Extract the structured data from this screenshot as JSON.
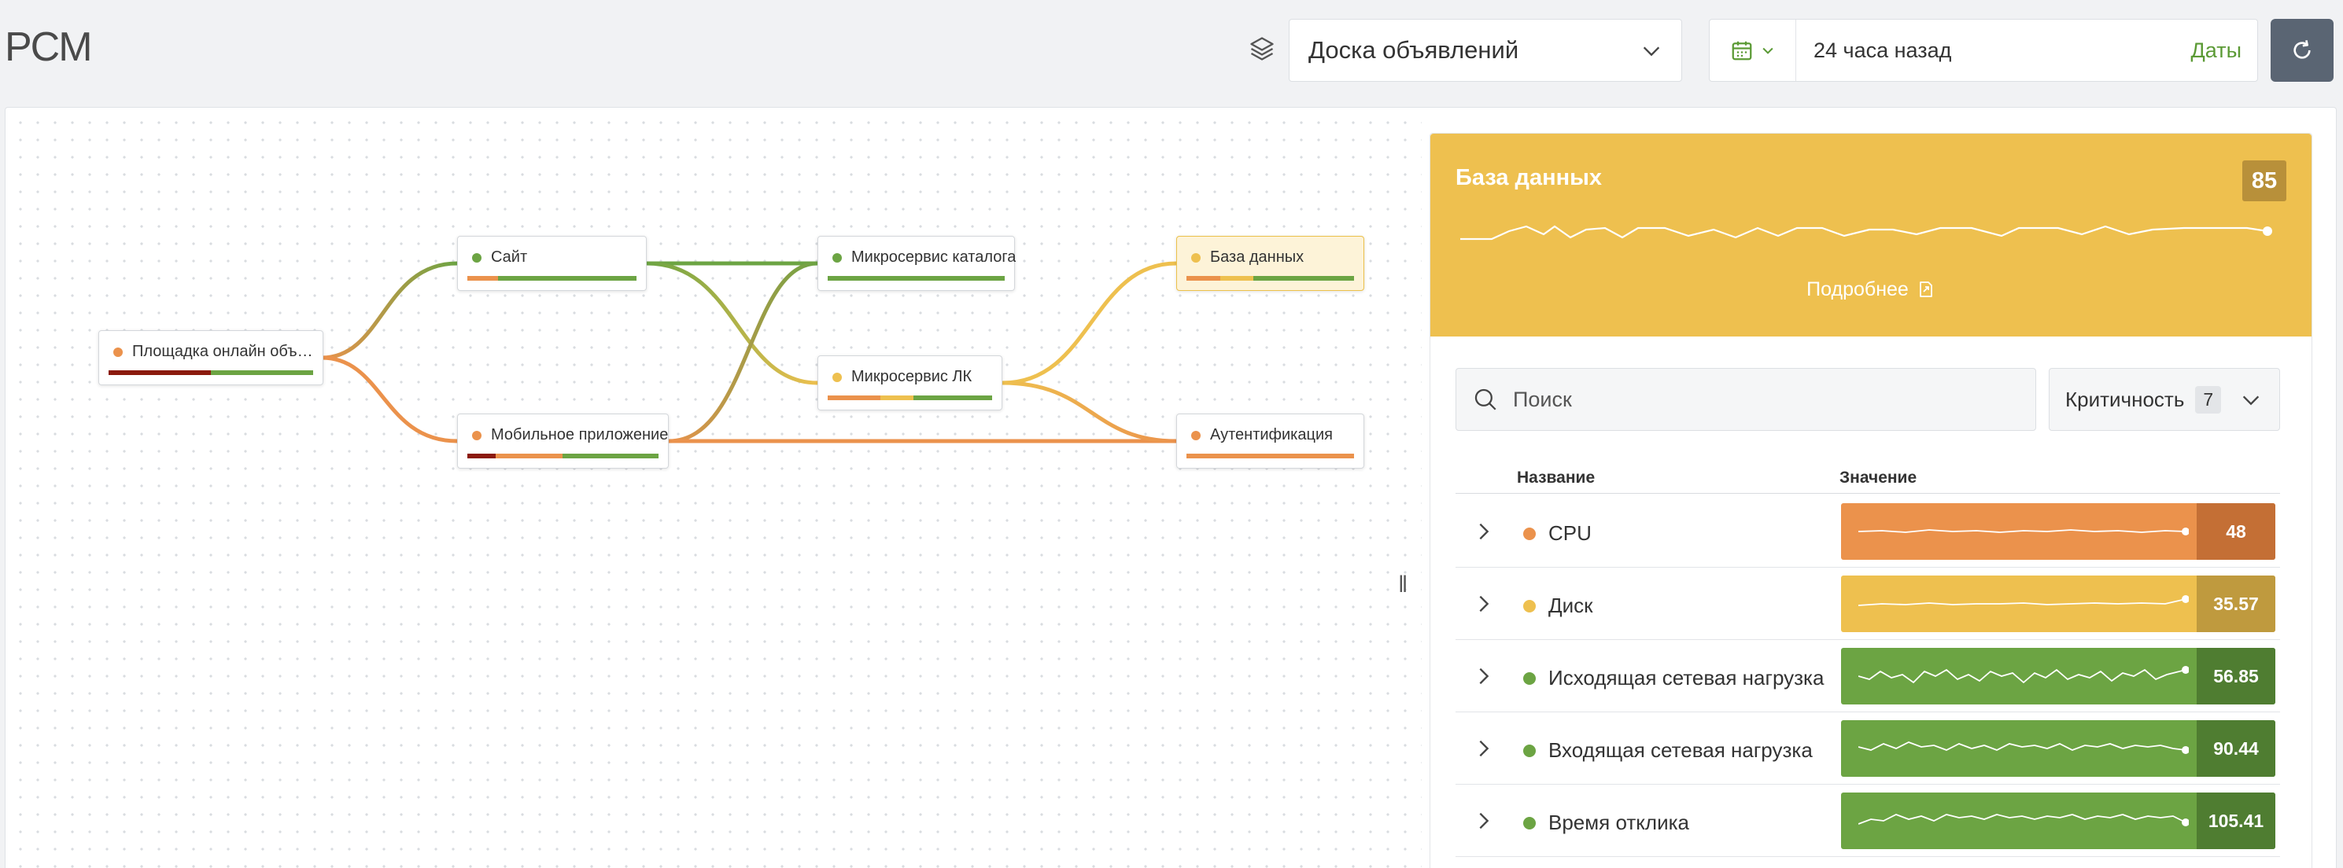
{
  "header": {
    "app_title": "PCM",
    "board": "Доска объявлений",
    "time_range": "24 часа назад",
    "dates_label": "Даты"
  },
  "graph": {
    "nodes": [
      {
        "id": "platform",
        "label": "Площадка онлайн объя...",
        "status": "orange"
      },
      {
        "id": "site",
        "label": "Сайт",
        "status": "green"
      },
      {
        "id": "mobile",
        "label": "Мобильное приложение",
        "status": "orange"
      },
      {
        "id": "catalog",
        "label": "Микросервис каталога",
        "status": "green"
      },
      {
        "id": "lk",
        "label": "Микросервис ЛК",
        "status": "yellow"
      },
      {
        "id": "db",
        "label": "База данных",
        "status": "yellow"
      },
      {
        "id": "auth",
        "label": "Аутентификация",
        "status": "orange"
      }
    ]
  },
  "detail": {
    "title": "База данных",
    "score": "85",
    "more_label": "Подробнее",
    "search_placeholder": "Поиск",
    "criticality_label": "Критичность",
    "criticality_count": "7",
    "columns": {
      "name": "Название",
      "value": "Значение"
    },
    "metrics": [
      {
        "name": "CPU",
        "value": "48",
        "status": "orange"
      },
      {
        "name": "Диск",
        "value": "35.57",
        "status": "yellow"
      },
      {
        "name": "Исходящая сетевая нагрузка",
        "value": "56.85",
        "status": "green"
      },
      {
        "name": "Входящая сетевая нагрузка",
        "value": "90.44",
        "status": "green"
      },
      {
        "name": "Время отклика",
        "value": "105.41",
        "status": "green"
      }
    ]
  },
  "colors": {
    "green": "#6ca443",
    "yellow": "#eec04f",
    "orange": "#eb924c",
    "dark_red": "#8b1a0d",
    "header_panel": "#eec04f"
  }
}
